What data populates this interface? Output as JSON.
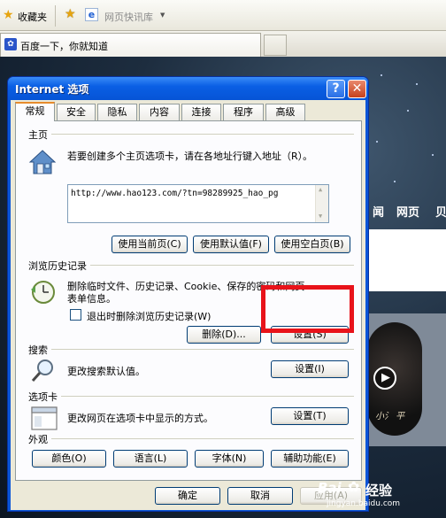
{
  "browser": {
    "favorites_label": "收藏夹",
    "quick_link_label": "网页快讯库",
    "tab_title": "百度一下，你就知道"
  },
  "background_page": {
    "nav_items": [
      "闻",
      "网页",
      "贝"
    ],
    "thumbnail_text": "小氵 平"
  },
  "dialog": {
    "title": "Internet 选项",
    "help_button": "?",
    "close_button": "✕",
    "tabs": [
      "常规",
      "安全",
      "隐私",
      "内容",
      "连接",
      "程序",
      "高级"
    ],
    "active_tab": "常规",
    "homepage": {
      "section": "主页",
      "description": "若要创建多个主页选项卡，请在各地址行键入地址（R）。",
      "url": "http://www.hao123.com/?tn=98289925_hao_pg",
      "use_current": "使用当前页(C)",
      "use_default": "使用默认值(F)",
      "use_blank": "使用空白页(B)"
    },
    "history": {
      "section": "浏览历史记录",
      "description_line1": "删除临时文件、历史记录、Cookie、保存的密码和网页",
      "description_line2": "表单信息。",
      "exit_delete": "退出时删除浏览历史记录(W)",
      "exit_delete_checked": false,
      "delete_button": "删除(D)...",
      "settings_button": "设置(S)"
    },
    "search": {
      "section": "搜索",
      "description": "更改搜索默认值。",
      "settings_button": "设置(I)"
    },
    "tabs_section": {
      "section": "选项卡",
      "description": "更改网页在选项卡中显示的方式。",
      "settings_button": "设置(T)"
    },
    "appearance": {
      "section": "外观",
      "colors": "颜色(O)",
      "languages": "语言(L)",
      "fonts": "字体(N)",
      "accessibility": "辅助功能(E)"
    },
    "footer": {
      "ok": "确定",
      "cancel": "取消",
      "apply": "应用(A)"
    }
  },
  "watermark": {
    "brand": "Bai",
    "brand_suffix": "经验",
    "site": "jingyan.baidu.com"
  },
  "colors": {
    "highlight": "#e8131a",
    "titlebar": "#0a5fe4"
  }
}
